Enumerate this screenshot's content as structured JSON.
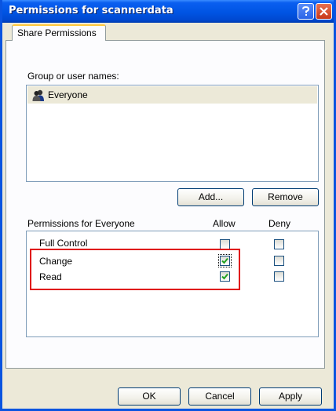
{
  "window": {
    "title": "Permissions for scannerdata"
  },
  "tabs": [
    {
      "label": "Share Permissions",
      "selected": true
    }
  ],
  "group": {
    "label": "Group or user names:",
    "users": [
      {
        "name": "Everyone",
        "selected": true,
        "icon": "user-group-icon"
      }
    ],
    "add_label": "Add...",
    "remove_label": "Remove"
  },
  "permissions": {
    "header": "Permissions for Everyone",
    "allow_label": "Allow",
    "deny_label": "Deny",
    "rows": [
      {
        "name": "Full Control",
        "allow": false,
        "deny": false
      },
      {
        "name": "Change",
        "allow": true,
        "deny": false
      },
      {
        "name": "Read",
        "allow": true,
        "deny": false
      }
    ]
  },
  "footer": {
    "ok_label": "OK",
    "cancel_label": "Cancel",
    "apply_label": "Apply"
  },
  "annotation": {
    "color": "#e01010"
  },
  "colors": {
    "titlebar": "#0054e3",
    "dialog_bg": "#ece9d8",
    "check": "#21a121"
  }
}
